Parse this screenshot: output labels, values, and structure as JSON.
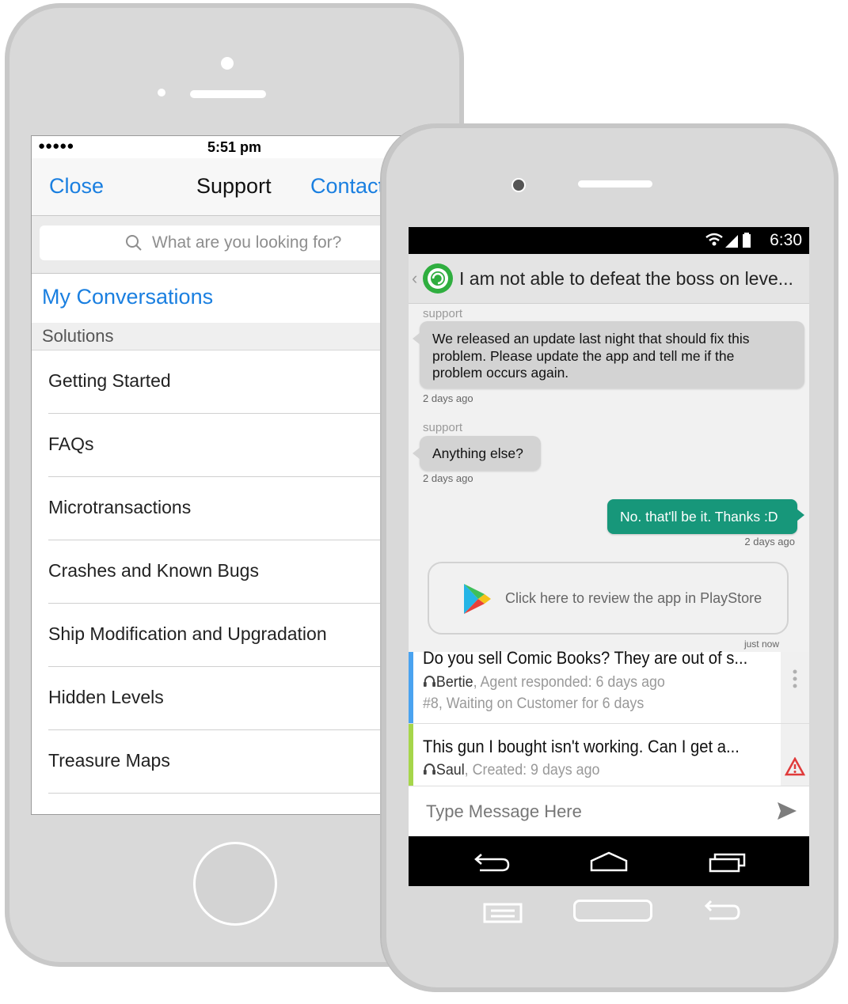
{
  "ios": {
    "status": {
      "signal": "●●●●●",
      "time": "5:51 pm"
    },
    "nav": {
      "close": "Close",
      "title": "Support",
      "contact": "Contact"
    },
    "search": {
      "placeholder": "What are you looking for?"
    },
    "my_conversations": "My Conversations",
    "section_header": "Solutions",
    "items": [
      {
        "label": "Getting Started"
      },
      {
        "label": "FAQs"
      },
      {
        "label": "Microtransactions"
      },
      {
        "label": "Crashes and Known Bugs"
      },
      {
        "label": "Ship Modification and Upgradation"
      },
      {
        "label": "Hidden Levels"
      },
      {
        "label": "Treasure Maps"
      }
    ]
  },
  "android": {
    "status": {
      "time": "6:30"
    },
    "conversation_title": "I am not able to defeat the boss on leve...",
    "messages": [
      {
        "sender": "support",
        "text_lines": [
          "We released an update last night that should fix this",
          "problem. Please update the app and tell me if the",
          "problem occurs again."
        ],
        "time": "2 days ago"
      },
      {
        "sender": "support",
        "text": "Anything else?",
        "time": "2 days ago"
      },
      {
        "text": "No. that'll be it. Thanks :D",
        "time": "2 days ago"
      }
    ],
    "review": {
      "text": "Click here to review the app in PlayStore",
      "time": "just now"
    },
    "issues": [
      {
        "subject": "Do you sell Comic Books? They are out of s...",
        "agent": "Bertie",
        "status": ", Agent responded: 6 days ago",
        "line2": "#8, Waiting on Customer for 6 days",
        "color": "#4aa3f0"
      },
      {
        "subject": "This gun I bought isn't working. Can I get a...",
        "agent": "Saul",
        "status": ", Created: 9 days ago",
        "color": "#a6d64a"
      }
    ],
    "compose": {
      "placeholder": "Type Message Here"
    }
  },
  "colors": {
    "ios_accent": "#1a7fe0",
    "android_accent": "#17977a"
  }
}
